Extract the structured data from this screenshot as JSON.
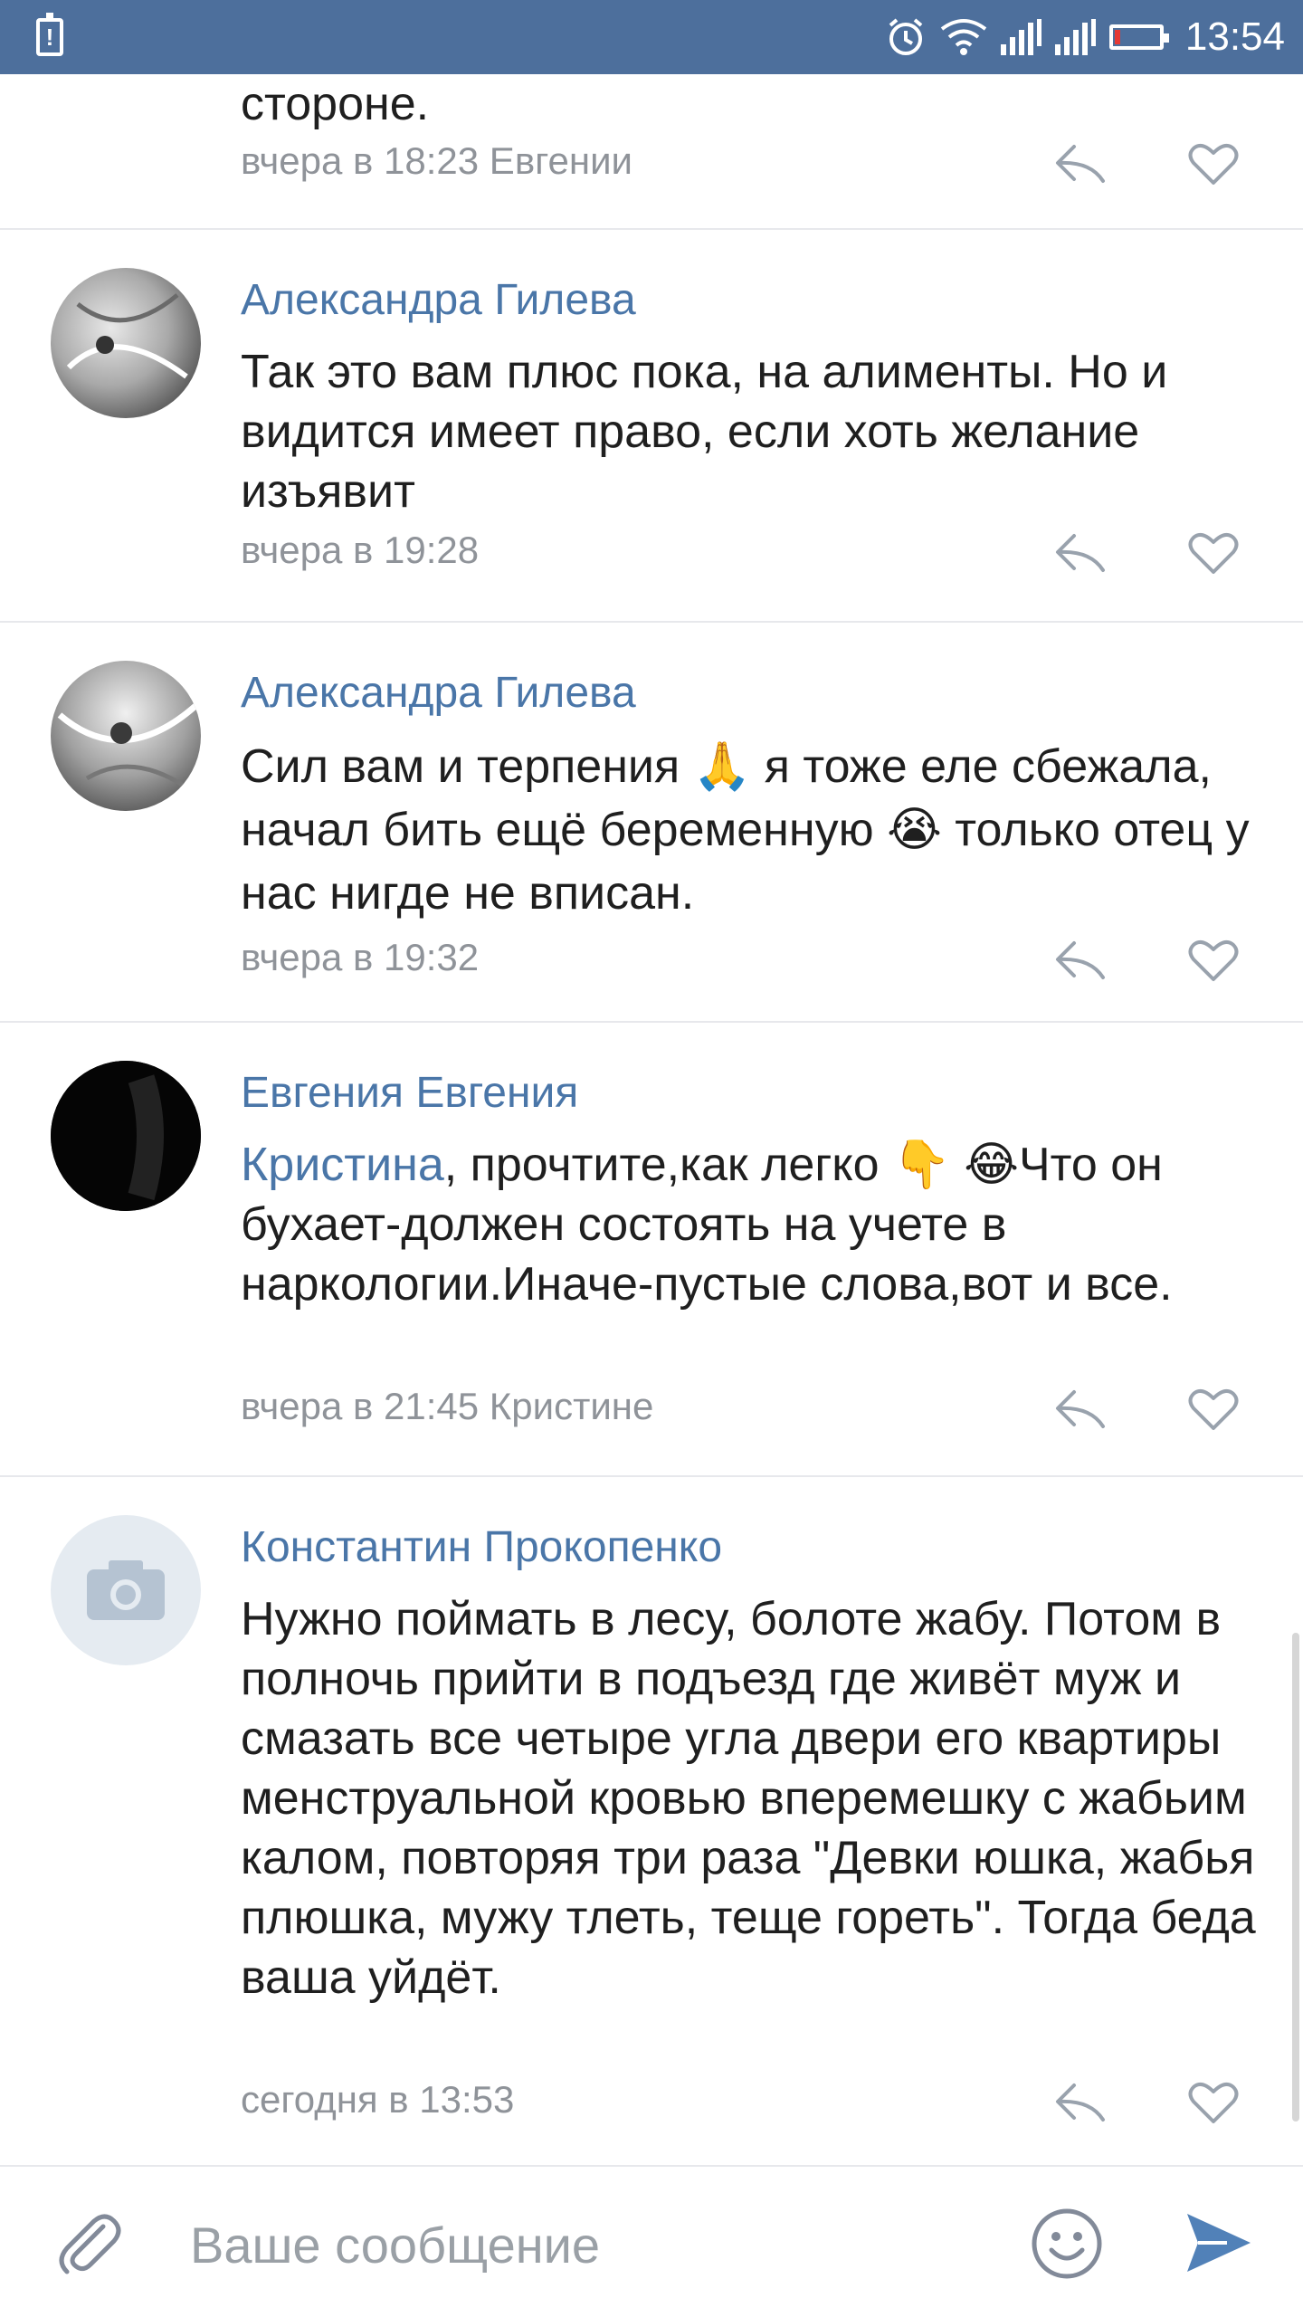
{
  "status_bar": {
    "time": "13:54",
    "icons": [
      "battery-alert-icon",
      "alarm-icon",
      "wifi-icon",
      "signal-icon",
      "signal-icon",
      "battery-low-icon"
    ],
    "background": "#4d6f9c"
  },
  "comments": [
    {
      "author": "",
      "text": "стороне.",
      "meta": "вчера в 18:23 Евгении",
      "avatar": "none"
    },
    {
      "author": "Александра Гилева",
      "text": "Так это вам плюс пока, на алименты. Но и видится имеет право, если хоть желание изъявит",
      "meta": "вчера в 19:28",
      "avatar": "photo-avatar"
    },
    {
      "author": "Александра Гилева",
      "text_parts": [
        "Сил вам и терпения ",
        "🙏",
        " я тоже еле сбежала, начал бить ещё беременную ",
        "😭",
        " только отец у нас нигде не вписан."
      ],
      "meta": "вчера в 19:32",
      "avatar": "photo-avatar"
    },
    {
      "author": "Евгения Евгения",
      "mention": "Кристина",
      "text_parts": [
        ", прочтите,как легко ",
        "👇",
        " ",
        "😂",
        "Что он бухает-должен состоять на учете в наркологии.Иначе-пустые слова,вот и все."
      ],
      "meta": "вчера в 21:45 Кристине",
      "avatar": "dark-avatar"
    },
    {
      "author": "Константин Прокопенко",
      "text": "Нужно поймать в лесу, болоте жабу. Потом в полночь прийти в подъезд где живёт муж и смазать все четыре угла двери его квартиры менструальной кровью вперемешку с жабьим калом, повторяя три раза \"Девки юшка, жабья плюшка, мужу тлеть, теще гореть\". Тогда беда ваша уйдёт.",
      "meta": "сегодня в 13:53",
      "avatar": "camera-placeholder-avatar"
    }
  ],
  "composer": {
    "placeholder": "Ваше сообщение",
    "value": ""
  },
  "colors": {
    "accent": "#4a76a8",
    "meta": "#8f9399",
    "divider": "#e7e8ec",
    "send": "#5181b8"
  }
}
